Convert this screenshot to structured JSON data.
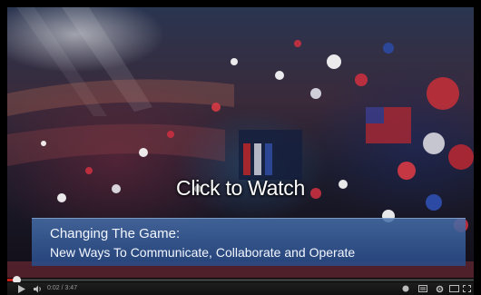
{
  "video": {
    "overlay_title": "Click to Watch",
    "lower_third": {
      "line1": "Changing The Game:",
      "line2": "New Ways To Communicate, Collaborate and Operate"
    },
    "progress_fraction": 0.02
  },
  "controls": {
    "time_display": "0:02 / 3:47",
    "icons": [
      "play-icon",
      "volume-icon",
      "cc-icon",
      "settings-icon",
      "watch-later-icon",
      "fullscreen-icon"
    ]
  },
  "colors": {
    "progress_played": "#c8201a",
    "lower_third_bg": "#466eaa"
  }
}
